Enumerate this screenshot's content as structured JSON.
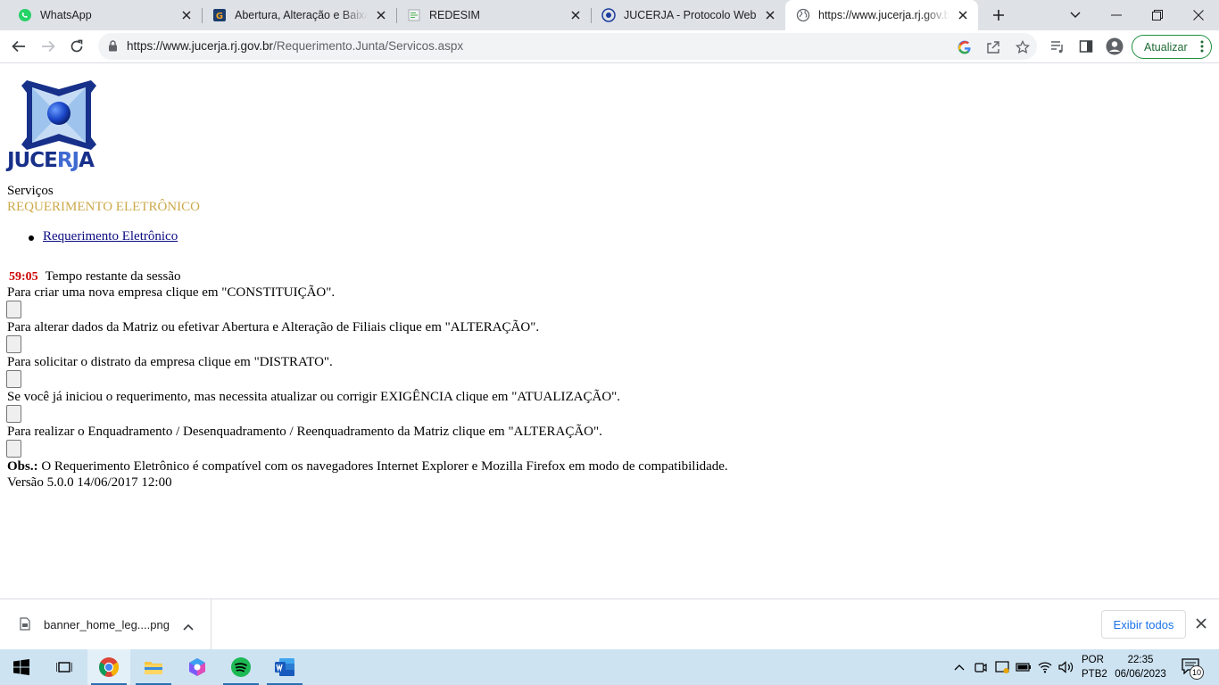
{
  "browser": {
    "tabs": [
      {
        "title": "WhatsApp",
        "icon": "whatsapp-icon"
      },
      {
        "title": "Abertura, Alteração e Baixa de",
        "icon": "gov-g-icon"
      },
      {
        "title": "REDESIM",
        "icon": "redesim-icon"
      },
      {
        "title": "JUCERJA - Protocolo Web",
        "icon": "jucerja-icon"
      },
      {
        "title": "https://www.jucerja.rj.gov.br/",
        "icon": "globe-icon",
        "active": true
      }
    ],
    "url_host": "https://www.jucerja.rj.gov.br",
    "url_path": "/Requerimento.Junta/Servicos.aspx",
    "update_label": "Atualizar"
  },
  "page": {
    "logo_text_1": "JUCE",
    "logo_text_2": "RJ",
    "logo_text_3": "A",
    "services_label": "Serviços",
    "section_title": "REQUERIMENTO ELETRÔNICO",
    "menu_link": "Requerimento Eletrônico",
    "session_timer": "59:05",
    "session_label": "Tempo restante da sessão",
    "instructions": [
      "Para criar uma nova empresa clique em \"CONSTITUIÇÃO\".",
      "Para alterar dados da Matriz ou efetivar Abertura e Alteração de Filiais clique em \"ALTERAÇÃO\".",
      "Para solicitar o distrato da empresa clique em \"DISTRATO\".",
      "Se você já iniciou o requerimento, mas necessita atualizar ou corrigir EXIGÊNCIA clique em \"ATUALIZAÇÃO\".",
      "Para realizar o Enquadramento / Desenquadramento / Reenquadramento da Matriz clique em \"ALTERAÇÃO\"."
    ],
    "obs_label": "Obs.:",
    "obs_text": " O Requerimento Eletrônico é compatível com os navegadores Internet Explorer e Mozilla Firefox em modo de compatibilidade.",
    "version": "Versão 5.0.0 14/06/2017 12:00"
  },
  "downloads": {
    "file_name": "banner_home_leg....png",
    "show_all_label": "Exibir todos"
  },
  "taskbar": {
    "lang_line1": "POR",
    "lang_line2": "PTB2",
    "time": "22:35",
    "date": "06/06/2023",
    "notification_count": "10"
  },
  "colors": {
    "section_title": "#cca94a",
    "timer": "#cc0000",
    "link": "#0b0b80",
    "update_border": "#1e8e3e"
  }
}
